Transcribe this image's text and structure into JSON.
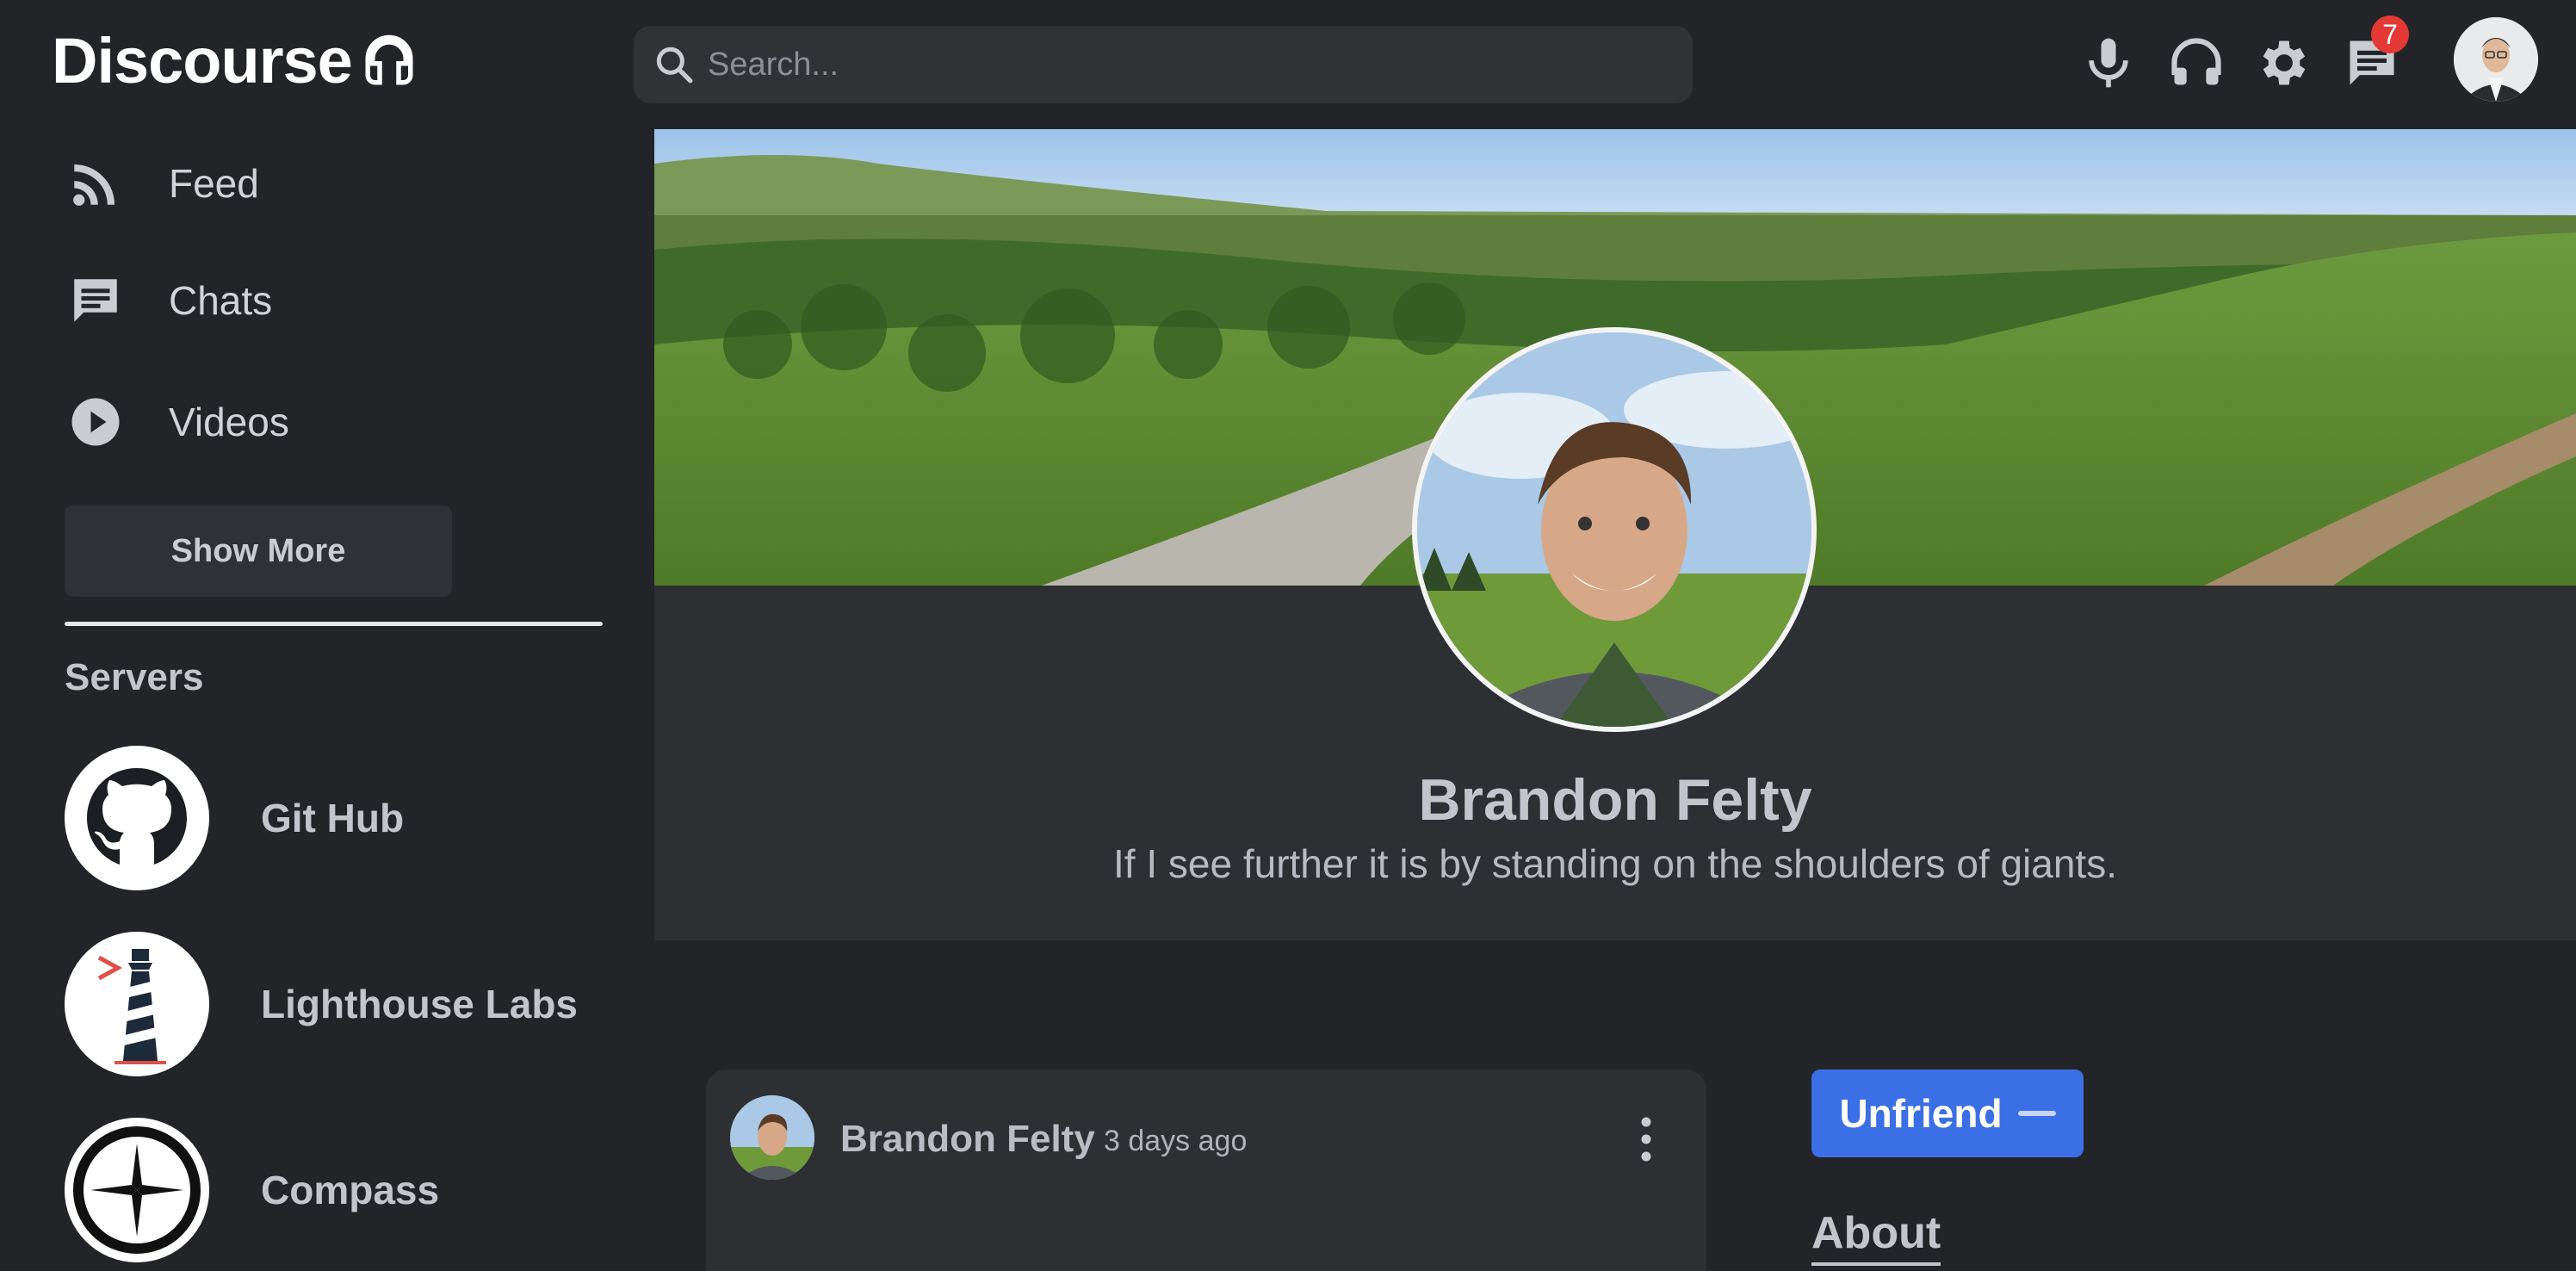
{
  "header": {
    "brand": "Discourse",
    "search_placeholder": "Search...",
    "messages_badge": "7"
  },
  "sidebar": {
    "nav": [
      {
        "label": "Feed",
        "icon": "rss-icon"
      },
      {
        "label": "Chats",
        "icon": "chat-icon"
      },
      {
        "label": "Videos",
        "icon": "play-icon"
      }
    ],
    "show_more_label": "Show More",
    "servers_title": "Servers",
    "servers": [
      {
        "name": "Git Hub",
        "icon": "github-icon"
      },
      {
        "name": "Lighthouse Labs",
        "icon": "lighthouse-icon"
      },
      {
        "name": "Compass",
        "icon": "compass-icon"
      }
    ]
  },
  "profile": {
    "name": "Brandon Felty",
    "bio": "If I see further it is by standing on the shoulders of giants."
  },
  "post": {
    "author": "Brandon Felty",
    "time": "3 days ago"
  },
  "actions": {
    "unfriend_label": "Unfriend"
  },
  "about_title": "About",
  "colors": {
    "background": "#222428",
    "panel": "#2d2f33",
    "accent": "#3b6fe5",
    "badge": "#e53935"
  }
}
